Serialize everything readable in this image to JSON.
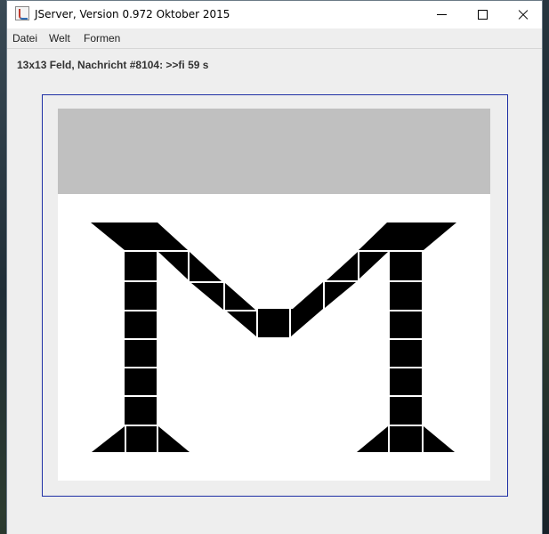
{
  "window": {
    "title": "JServer, Version 0.972 Oktober 2015",
    "controls": [
      "minimize-icon",
      "maximize-icon",
      "close-icon"
    ]
  },
  "menu": {
    "datei": "Datei",
    "welt": "Welt",
    "formen": "Formen"
  },
  "status": {
    "message": "13x13 Feld, Nachricht #8104: >>fi 59 s"
  },
  "board": {
    "background": "#ffffff",
    "banner_color": "#c0c0c0",
    "shape_color": "#000000",
    "frame_color": "#1f2fa5"
  }
}
